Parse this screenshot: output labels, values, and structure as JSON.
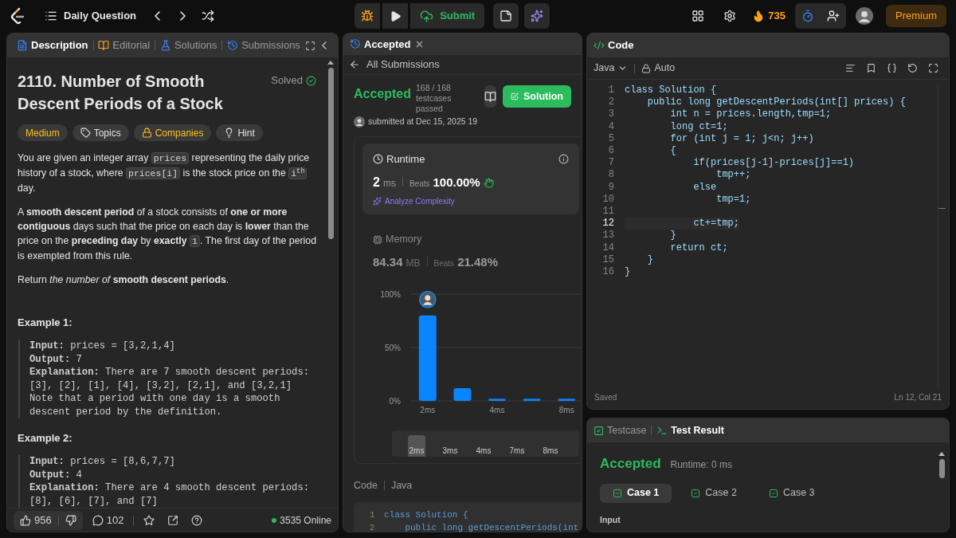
{
  "topbar": {
    "title": "Daily Question",
    "submit": "Submit",
    "streak": "735",
    "premium": "Premium"
  },
  "left": {
    "tabs": [
      {
        "label": "Description",
        "selected": true
      },
      {
        "label": "Editorial",
        "selected": false
      },
      {
        "label": "Solutions",
        "selected": false
      },
      {
        "label": "Submissions",
        "selected": false
      }
    ],
    "title": "2110. Number of Smooth Descent Periods of a Stock",
    "status": "Solved",
    "tags": [
      {
        "label": "Medium",
        "kind": "difficulty"
      },
      {
        "label": "Topics",
        "kind": "topics"
      },
      {
        "label": "Companies",
        "kind": "companies"
      },
      {
        "label": "Hint",
        "kind": "hint"
      }
    ],
    "paragraphs": [
      [
        {
          "kind": "text",
          "t": "You are given an integer array "
        },
        {
          "kind": "code",
          "t": "prices"
        },
        {
          "kind": "text",
          "t": " representing the daily price history of a stock, where "
        },
        {
          "kind": "code",
          "t": "prices[i]"
        },
        {
          "kind": "text",
          "t": " is the stock price on the "
        },
        {
          "kind": "code",
          "t": "i$^{th}$"
        },
        {
          "kind": "text",
          "t": " day."
        }
      ],
      [
        {
          "kind": "text",
          "t": "A **smooth descent period** of a stock consists of **one or more contiguous** days such that the price on each day is **lower** than the price on the **preceding day** by **exactly** "
        },
        {
          "kind": "code",
          "t": "1"
        },
        {
          "kind": "text",
          "t": ". The first day of the period is exempted from this rule."
        }
      ],
      [
        {
          "kind": "text",
          "t": "Return *the number of* **smooth descent periods**."
        }
      ]
    ],
    "examples": [
      {
        "title": "Example 1:",
        "lines": [
          "**Input:** prices = [3,2,1,4]",
          "**Output:** 7",
          "**Explanation:** There are 7 smooth descent periods:",
          "[3], [2], [1], [4], [3,2], [2,1], and [3,2,1]",
          "Note that a period with one day is a smooth",
          "descent period by the definition."
        ]
      },
      {
        "title": "Example 2:",
        "lines": [
          "**Input:** prices = [8,6,7,7]",
          "**Output:** 4",
          "**Explanation:** There are 4 smooth descent periods:",
          "[8], [6], [7], and [7]"
        ]
      }
    ],
    "footer": {
      "likes": "956",
      "comments": "102",
      "online": "3535 Online"
    }
  },
  "middle": {
    "tab": "Accepted",
    "back": "All Submissions",
    "verdict": "Accepted",
    "testcases": "168 / 168 testcases passed",
    "submitted": "submitted at Dec 15, 2025 19",
    "solution_button": "Solution",
    "runtime": {
      "label": "Runtime",
      "value": "2",
      "unit": "ms",
      "beats_label": "Beats",
      "beats": "100.00%",
      "analyze": "Analyze Complexity"
    },
    "memory": {
      "label": "Memory",
      "value": "84.34",
      "unit": "MB",
      "beats_label": "Beats",
      "beats": "21.48%"
    },
    "chart_data": {
      "type": "bar",
      "categories": [
        "2ms",
        null,
        "4ms",
        null,
        "8ms"
      ],
      "values": [
        80,
        12,
        2,
        2,
        2
      ],
      "ylim": [
        0,
        100
      ],
      "yticks": [
        {
          "value": 0,
          "label": "0%"
        },
        {
          "value": 50,
          "label": "50%"
        },
        {
          "value": 100,
          "label": "100%"
        }
      ]
    },
    "range": [
      {
        "label": "2ms",
        "selected": true
      },
      {
        "label": "3ms",
        "selected": false
      },
      {
        "label": "4ms",
        "selected": false
      },
      {
        "label": "7ms",
        "selected": false
      },
      {
        "label": "8ms",
        "selected": false
      }
    ],
    "code_label": "Code",
    "language": "Java",
    "code_preview": [
      {
        "n": "1",
        "t": "class Solution {"
      },
      {
        "n": "2",
        "t": "    public long getDescentPeriods(int"
      }
    ]
  },
  "editor": {
    "title": "Code",
    "language": "Java",
    "mode": "Auto",
    "lines": [
      {
        "n": "1",
        "t": "class Solution {",
        "current": false
      },
      {
        "n": "2",
        "t": "    public long getDescentPeriods(int[] prices) {",
        "current": false
      },
      {
        "n": "3",
        "t": "        int n = prices.length,tmp=1;",
        "current": false
      },
      {
        "n": "4",
        "t": "        long ct=1;",
        "current": false
      },
      {
        "n": "5",
        "t": "        for (int j = 1; j<n; j++)",
        "current": false
      },
      {
        "n": "6",
        "t": "        {",
        "current": false
      },
      {
        "n": "7",
        "t": "            if(prices[j-1]-prices[j]==1)",
        "current": false
      },
      {
        "n": "8",
        "t": "                tmp++;",
        "current": false
      },
      {
        "n": "9",
        "t": "            else",
        "current": false
      },
      {
        "n": "10",
        "t": "                tmp=1;",
        "current": false
      },
      {
        "n": "11",
        "current": false
      },
      {
        "n": "12",
        "t": "            ct+=tmp;",
        "current": true
      },
      {
        "n": "13",
        "t": "        }",
        "current": false
      },
      {
        "n": "14",
        "t": "        return ct;",
        "current": false
      },
      {
        "n": "15",
        "t": "    }",
        "current": false
      },
      {
        "n": "16",
        "t": "}",
        "current": false
      }
    ],
    "saved": "Saved",
    "cursor": "Ln 12, Col 21"
  },
  "result": {
    "tabs": [
      {
        "label": "Testcase",
        "selected": false
      },
      {
        "label": "Test Result",
        "selected": true
      }
    ],
    "verdict": "Accepted",
    "runtime": "Runtime: 0 ms",
    "cases": [
      {
        "label": "Case 1",
        "selected": true
      },
      {
        "label": "Case 2",
        "selected": false
      },
      {
        "label": "Case 3",
        "selected": false
      }
    ],
    "input_label": "Input"
  }
}
